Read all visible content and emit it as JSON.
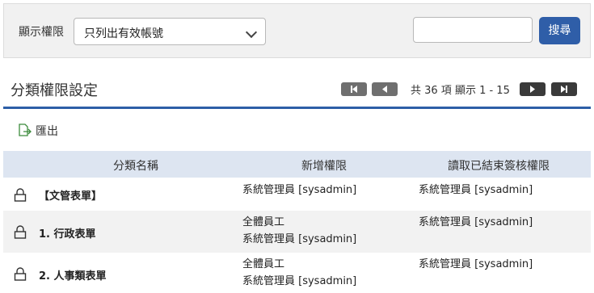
{
  "filter": {
    "label": "顯示權限",
    "select_value": "只列出有效帳號",
    "search_placeholder": "",
    "search_button": "搜尋"
  },
  "section": {
    "title": "分類權限設定",
    "page_info": "共 36 項 顯示 1 - 15"
  },
  "toolbar": {
    "export_label": "匯出"
  },
  "table": {
    "headers": [
      "分類名稱",
      "新增權限",
      "讀取已結束簽核權限"
    ],
    "rows": [
      {
        "name": "【文管表單】",
        "add": [
          "系統管理員 [sysadmin]"
        ],
        "read": [
          "系統管理員 [sysadmin]"
        ]
      },
      {
        "name": "1. 行政表單",
        "add": [
          "全體員工",
          "系統管理員 [sysadmin]"
        ],
        "read": [
          "系統管理員 [sysadmin]"
        ]
      },
      {
        "name": "2. 人事類表單",
        "add": [
          "全體員工",
          "系統管理員 [sysadmin]"
        ],
        "read": [
          "系統管理員 [sysadmin]"
        ]
      }
    ]
  },
  "icons": {
    "lock": "lock-icon",
    "export": "export-icon",
    "chevron": "chevron-down-icon",
    "first": "first-page-icon",
    "prev": "prev-page-icon",
    "next": "next-page-icon",
    "last": "last-page-icon"
  },
  "colors": {
    "accent": "#2f5ea8",
    "header_bg": "#dde5f1",
    "rule": "#2d5ea7"
  }
}
